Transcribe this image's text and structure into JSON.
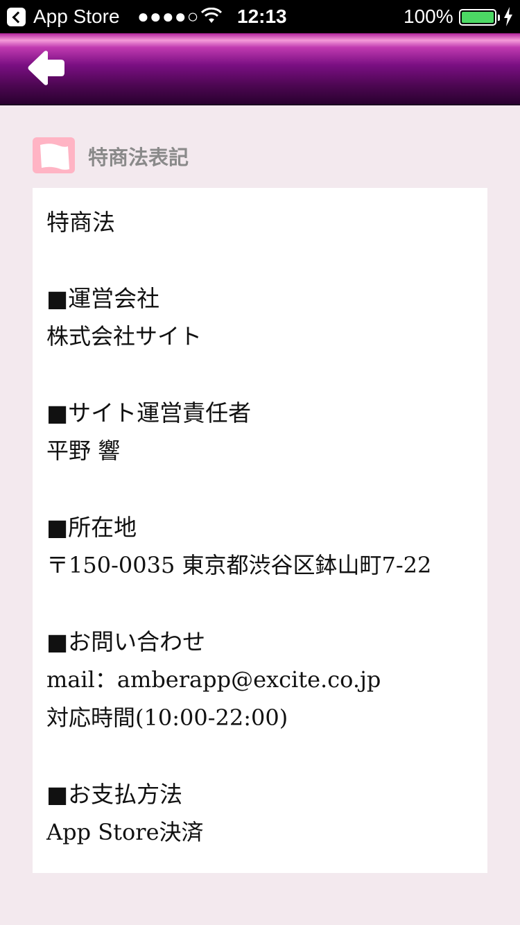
{
  "status_bar": {
    "back_app": "App Store",
    "signal": "●●●●○",
    "time": "12:13",
    "battery": "100%"
  },
  "nav": {
    "back_icon": "arrow-left-icon"
  },
  "section": {
    "icon": "flag-icon",
    "title": "特商法表記"
  },
  "content": {
    "title": "特商法",
    "operator_heading": "■運営会社",
    "operator_value": "株式会社サイト",
    "manager_heading": "■サイト運営責任者",
    "manager_value": "平野 響",
    "address_heading": "■所在地",
    "address_value": "〒150-0035 東京都渋谷区鉢山町7-22",
    "contact_heading": "■お問い合わせ",
    "contact_mail": "mail：amberapp@excite.co.jp",
    "contact_hours": "対応時間(10:00-22:00)",
    "payment_heading": "■お支払方法",
    "payment_value": "App Store決済"
  }
}
